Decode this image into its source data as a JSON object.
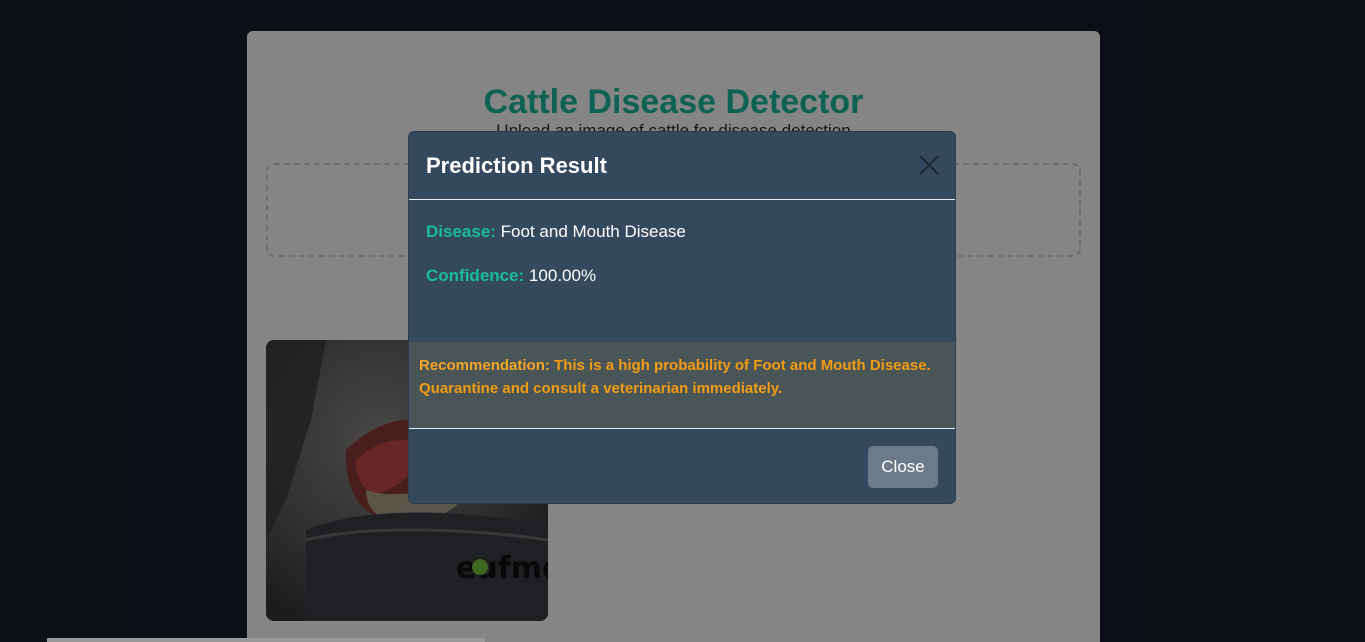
{
  "app": {
    "title": "Cattle Disease Detector",
    "subtitle": "Upload an image of cattle for disease detection"
  },
  "preview": {
    "watermark_text": "eufmd"
  },
  "modal": {
    "title": "Prediction Result",
    "close_icon": "close-icon",
    "disease_label": "Disease:",
    "disease_value": "Foot and Mouth Disease",
    "confidence_label": "Confidence:",
    "confidence_value": "100.00%",
    "recommendation_label": "Recommendation:",
    "recommendation_text": "This is a high probability of Foot and Mouth Disease. Quarantine and consult a veterinarian immediately.",
    "close_button_label": "Close"
  },
  "colors": {
    "accent": "#1abc9c",
    "modal_bg": "#34495e",
    "warning": "#f39c12",
    "page_bg": "#18202b"
  }
}
